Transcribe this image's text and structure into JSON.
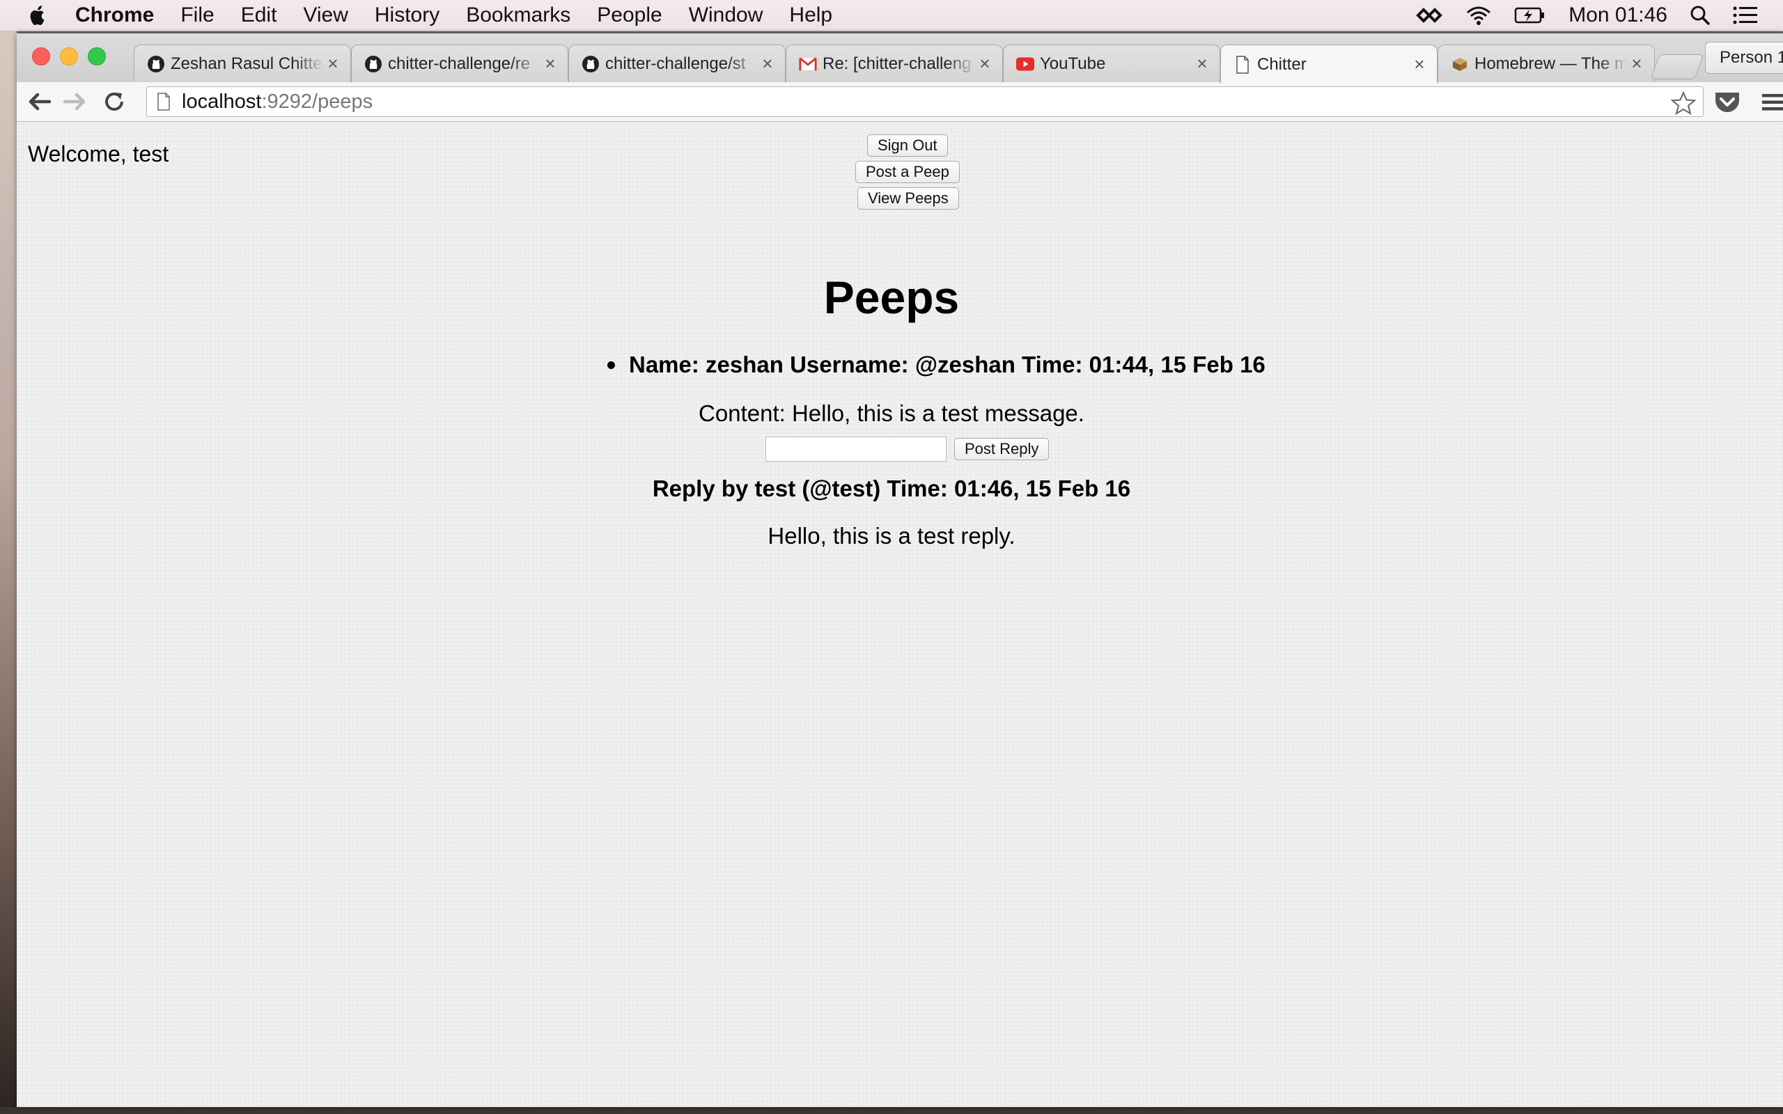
{
  "menubar": {
    "app_name": "Chrome",
    "items": [
      "File",
      "Edit",
      "View",
      "History",
      "Bookmarks",
      "People",
      "Window",
      "Help"
    ],
    "clock": "Mon 01:46"
  },
  "tabs": [
    {
      "title": "Zeshan Rasul Chitter",
      "icon": "github-icon",
      "active": false
    },
    {
      "title": "chitter-challenge/re",
      "icon": "github-icon",
      "active": false
    },
    {
      "title": "chitter-challenge/st",
      "icon": "github-icon",
      "active": false
    },
    {
      "title": "Re: [chitter-challeng",
      "icon": "gmail-icon",
      "active": false
    },
    {
      "title": "YouTube",
      "icon": "youtube-icon",
      "active": false
    },
    {
      "title": "Chitter",
      "icon": "page-icon",
      "active": true
    },
    {
      "title": "Homebrew — The m",
      "icon": "homebrew-icon",
      "active": false
    }
  ],
  "profile": {
    "label": "Person 1"
  },
  "address_bar": {
    "host": "localhost",
    "path": ":9292/peeps"
  },
  "page": {
    "welcome": "Welcome, test",
    "buttons": {
      "sign_out": "Sign Out",
      "post_peep": "Post a Peep",
      "view_peeps": "View Peeps"
    },
    "title": "Peeps",
    "peep": {
      "header": "Name: zeshan Username: @zeshan Time: 01:44, 15 Feb 16",
      "content": "Content: Hello, this is a test message.",
      "reply_input_value": "",
      "reply_button": "Post Reply"
    },
    "reply": {
      "header": "Reply by test (@test) Time: 01:46, 15 Feb 16",
      "content": "Hello, this is a test reply."
    }
  },
  "colors": {
    "close_red": "#fc605c",
    "minimize_yellow": "#fdbc40",
    "zoom_green": "#34c84a",
    "youtube_red": "#e52d27",
    "gmail_red": "#d93025"
  }
}
